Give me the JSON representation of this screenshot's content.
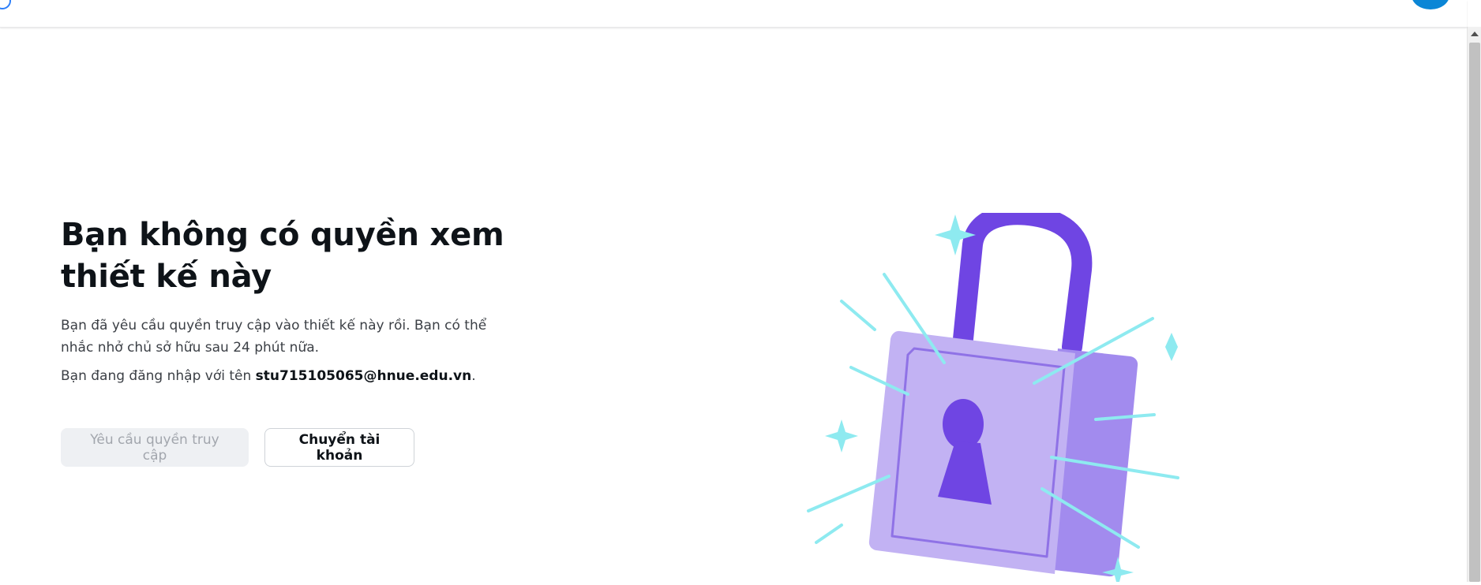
{
  "page": {
    "heading": "Bạn không có quyền xem thiết kế này",
    "description": "Bạn đã yêu cầu quyền truy cập vào thiết kế này rồi. Bạn có thể nhắc nhở chủ sở hữu sau 24 phút nữa.",
    "signed_in_prefix": "Bạn đang đăng nhập với tên ",
    "signed_in_email": "stu715105065@hnue.edu.vn",
    "signed_in_suffix": "."
  },
  "actions": {
    "request_access_label": "Yêu cầu quyền truy cập",
    "switch_account_label": "Chuyển tài khoản"
  },
  "illustration": {
    "icon": "lock-icon",
    "colors": {
      "shackle": "#6f45e3",
      "body_front": "#c2b2f3",
      "body_side": "#a28bee",
      "keyhole": "#6f45e3",
      "sparkle": "#8eeaf0"
    }
  },
  "colors": {
    "topbar_avatar": "#0b86d6",
    "text_primary": "#0e1318",
    "text_secondary": "#3b3f45",
    "button_disabled_bg": "#eef0f3",
    "button_disabled_text": "#a2a6ad"
  }
}
